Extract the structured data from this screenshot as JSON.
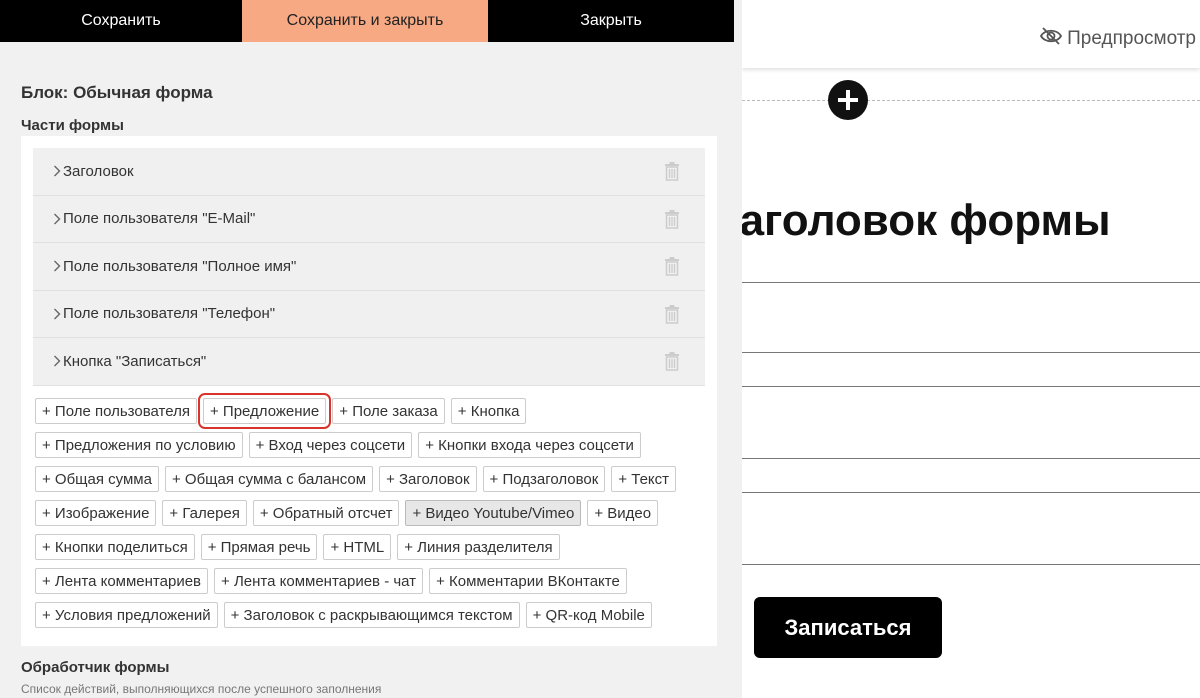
{
  "toolbar": {
    "save_label": "Сохранить",
    "save_close_label": "Сохранить и закрыть",
    "close_label": "Закрыть"
  },
  "editor": {
    "block_title": "Блок: Обычная форма",
    "parts_title": "Части формы",
    "parts": [
      {
        "label": "Заголовок"
      },
      {
        "label": "Поле пользователя \"E-Mail\""
      },
      {
        "label": "Поле пользователя \"Полное имя\""
      },
      {
        "label": "Поле пользователя \"Телефон\""
      },
      {
        "label": "Кнопка \"Записаться\""
      }
    ],
    "add_chip_rows": [
      [
        "+ Поле пользователя",
        "+ Предложение",
        "+ Поле заказа",
        "+ Кнопка"
      ],
      [
        "+ Предложения по условию",
        "+ Вход через соцсети",
        "+ Кнопки входа через соцсети"
      ],
      [
        "+ Общая сумма",
        "+ Общая сумма с балансом",
        "+ Заголовок",
        "+ Подзаголовок",
        "+ Текст"
      ],
      [
        "+ Изображение",
        "+ Галерея",
        "+ Обратный отсчет",
        "+ Видео Youtube/Vimeo",
        "+ Видео"
      ],
      [
        "+ Кнопки поделиться",
        "+ Прямая речь",
        "+ HTML",
        "+ Линия разделителя"
      ],
      [
        "+ Лента комментариев",
        "+ Лента комментариев - чат",
        "+ Комментарии ВКонтакте"
      ],
      [
        "+ Условия предложений",
        "+ Заголовок с раскрывающимся текстом",
        "+ QR-код Mobile"
      ]
    ],
    "selected_chip": "+ Предложение",
    "hovered_chip": "+ Видео Youtube/Vimeo",
    "handler_title": "Обработчик формы",
    "handler_subtitle": "Список действий, выполняющихся после успешного заполнения"
  },
  "preview": {
    "toggle_label": "Предпросмотр",
    "form_title": "Заголовок формы",
    "submit_label": "Записаться"
  },
  "colors": {
    "accent": "#f7a983",
    "selection": "#d9342b",
    "dark": "#000000"
  }
}
